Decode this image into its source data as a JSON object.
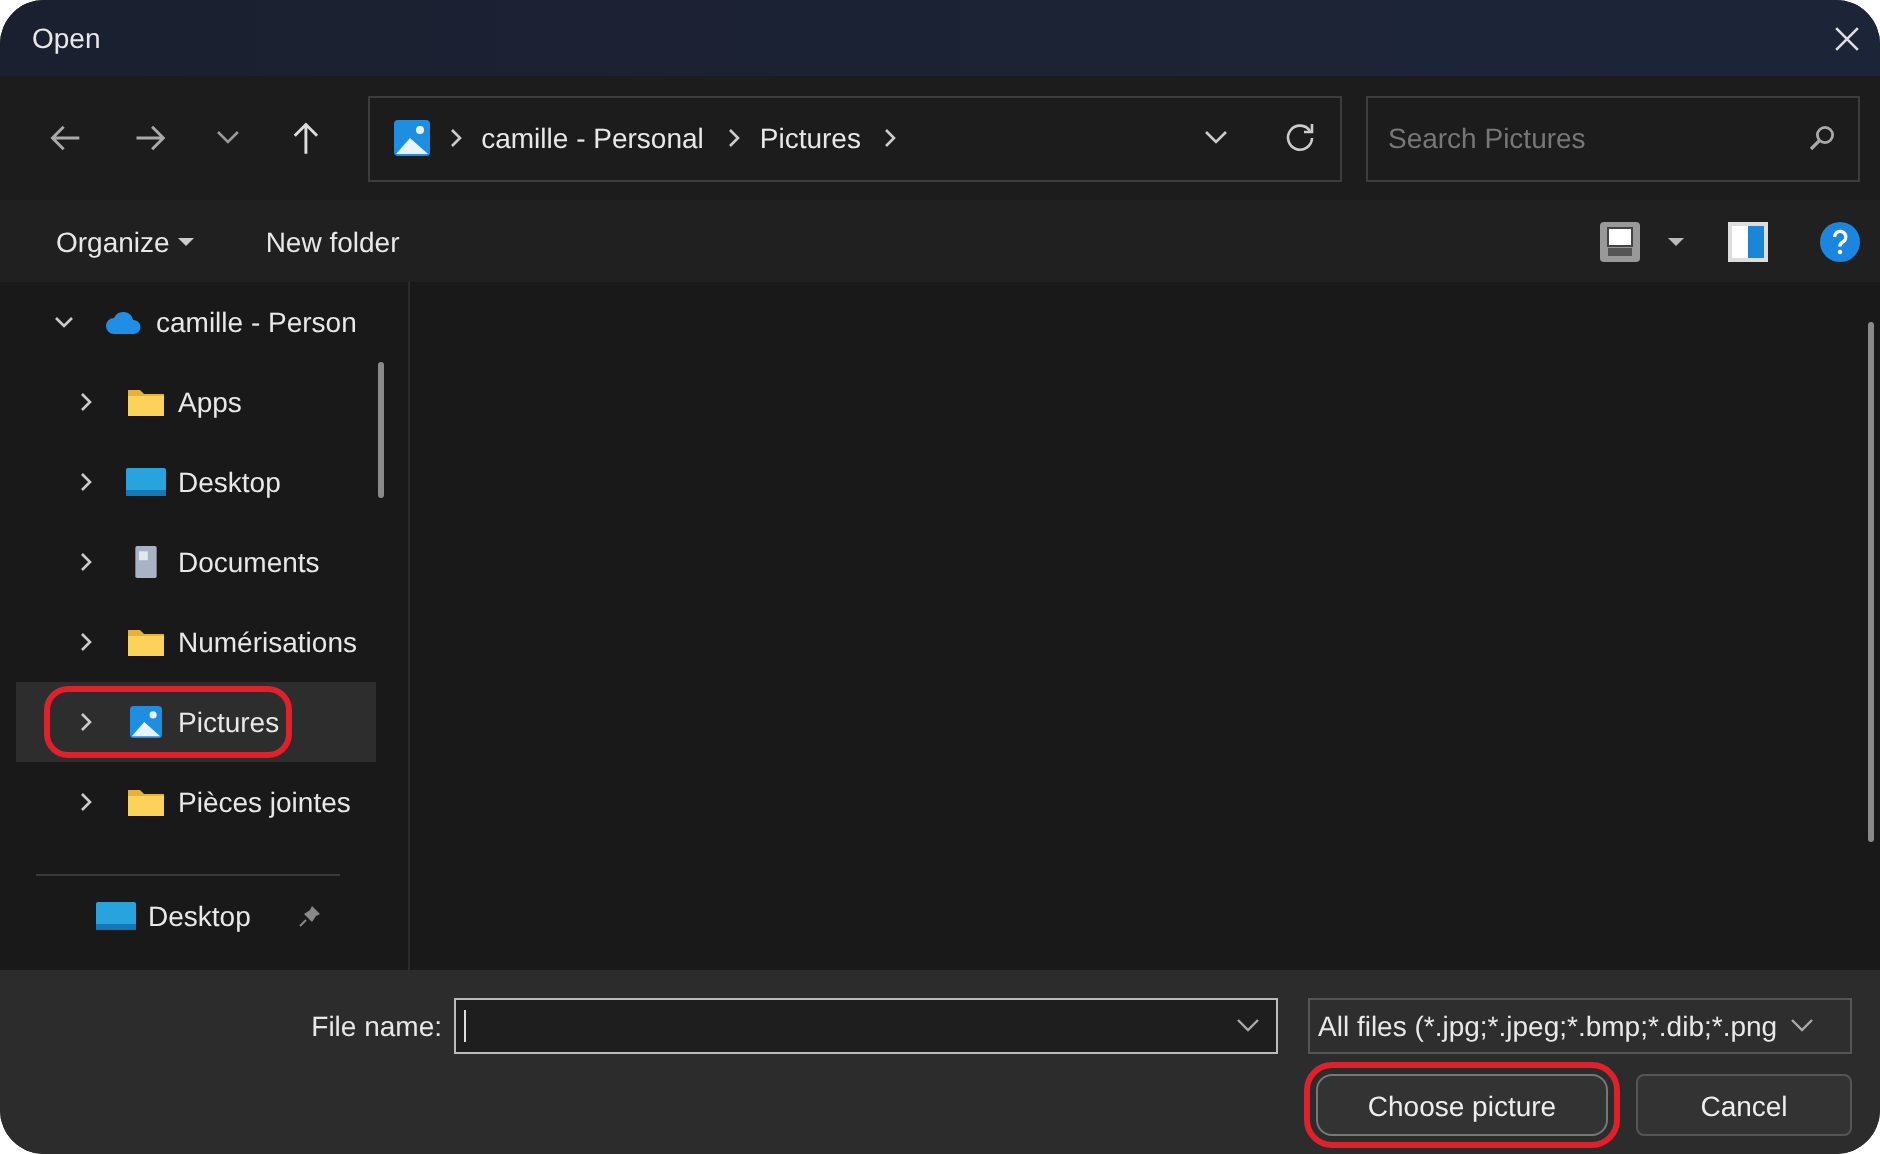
{
  "window": {
    "title": "Open"
  },
  "navigation": {
    "breadcrumb": [
      "camille - Personal",
      "Pictures"
    ],
    "search": {
      "placeholder": "Search Pictures"
    }
  },
  "command_bar": {
    "organize": "Organize",
    "new_folder": "New folder"
  },
  "tree": [
    {
      "label": "camille - Person",
      "kind": "cloud",
      "expanded": true,
      "selected": false,
      "highlighted": false,
      "children": [
        {
          "label": "Apps",
          "kind": "folder",
          "expanded": false,
          "selected": false,
          "highlighted": false
        },
        {
          "label": "Desktop",
          "kind": "desktop",
          "expanded": false,
          "selected": false,
          "highlighted": false
        },
        {
          "label": "Documents",
          "kind": "documents",
          "expanded": false,
          "selected": false,
          "highlighted": false
        },
        {
          "label": "Numérisations",
          "kind": "folder",
          "expanded": false,
          "selected": false,
          "highlighted": false
        },
        {
          "label": "Pictures",
          "kind": "pictures",
          "expanded": false,
          "selected": true,
          "highlighted": true
        },
        {
          "label": "Pièces jointes",
          "kind": "folder",
          "expanded": false,
          "selected": false,
          "highlighted": false
        }
      ]
    }
  ],
  "quick_access": [
    {
      "label": "Desktop",
      "kind": "desktop",
      "pinned": true
    }
  ],
  "footer": {
    "file_name_label": "File name:",
    "file_type": "All files (*.jpg;*.jpeg;*.bmp;*.dib;*.png",
    "buttons": [
      {
        "label": "Choose picture",
        "kind": "primary",
        "highlighted": true
      },
      {
        "label": "Cancel",
        "kind": "secondary",
        "highlighted": false
      }
    ]
  }
}
